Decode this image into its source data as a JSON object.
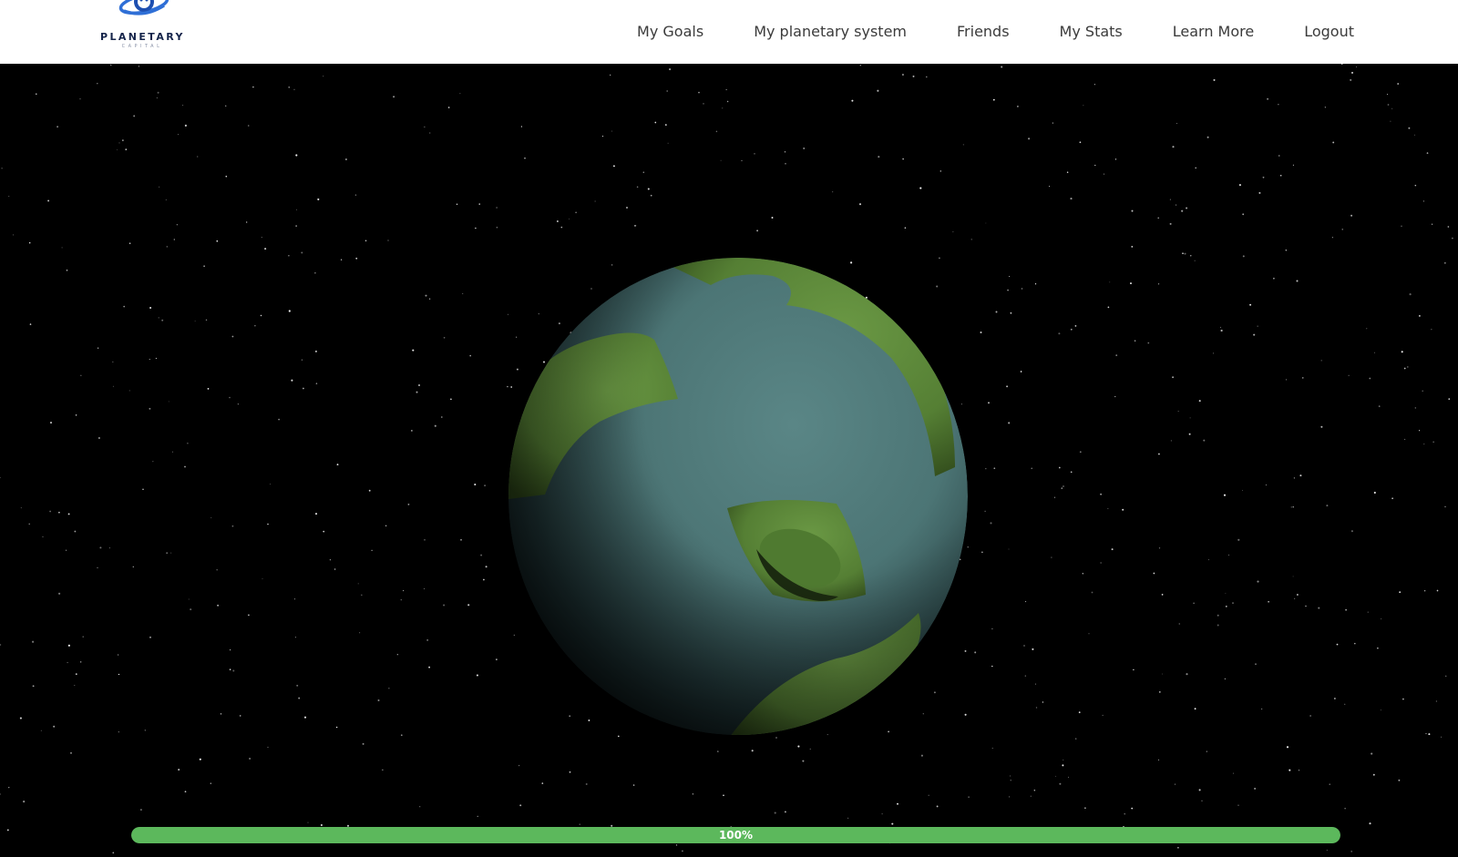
{
  "brand": {
    "name": "PLANETARY",
    "subtitle": "CAPITAL",
    "logo_icon": "planet-ring-logo-icon"
  },
  "nav": {
    "items": [
      {
        "label": "My Goals"
      },
      {
        "label": "My planetary system"
      },
      {
        "label": "Friends"
      },
      {
        "label": "My Stats"
      },
      {
        "label": "Learn More"
      },
      {
        "label": "Logout"
      }
    ]
  },
  "progress": {
    "value": 1.0,
    "label": "100%"
  },
  "colors": {
    "navbar_bg": "#ffffff",
    "nav_text": "#3b3b3b",
    "brand_navy": "#15244a",
    "brand_blue": "#2f6fd6",
    "space_bg": "#000000",
    "ocean": "#527a7a",
    "land": "#5e8c3a",
    "progress_fill": "#5cb85c"
  }
}
